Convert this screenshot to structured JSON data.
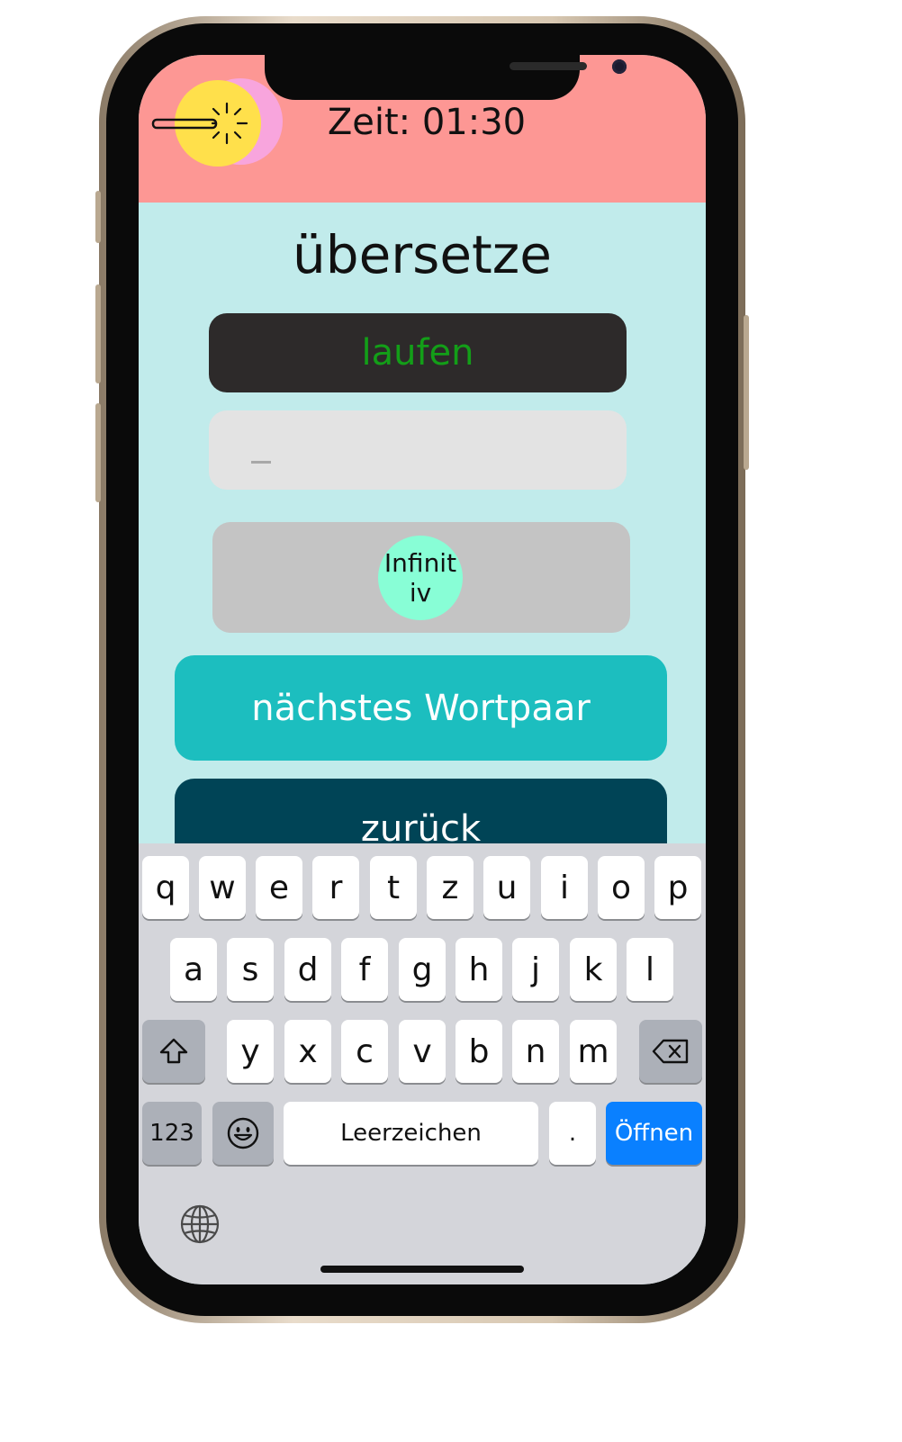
{
  "header": {
    "timer": "Zeit: 01:30",
    "menu_icon": "magic-wand-icon",
    "colors": {
      "header_bg": "#fd9794",
      "menu_yellow": "#ffe04b",
      "menu_pink": "#f8a5dd"
    }
  },
  "main": {
    "title": "übersetze",
    "word": "laufen",
    "answer_value": "",
    "hint_label": "Infinitiv",
    "next_button": "nächstes Wortpaar",
    "back_button": "zurück",
    "colors": {
      "background": "#c1ebeb",
      "word_card_bg": "#2d2a2a",
      "word_text": "#139e18",
      "answer_bg": "#e3e3e3",
      "hint_panel_bg": "#c4c4c4",
      "hint_bubble_bg": "#88fed6",
      "next_button_bg": "#1cbebf",
      "back_button_bg": "#004456"
    }
  },
  "keyboard": {
    "row1": [
      "q",
      "w",
      "e",
      "r",
      "t",
      "z",
      "u",
      "i",
      "o",
      "p"
    ],
    "row2": [
      "a",
      "s",
      "d",
      "f",
      "g",
      "h",
      "j",
      "k",
      "l"
    ],
    "row3": [
      "y",
      "x",
      "c",
      "v",
      "b",
      "n",
      "m"
    ],
    "shift_icon": "shift-icon",
    "backspace_icon": "backspace-icon",
    "numbers_key": "123",
    "emoji_icon": "emoji-icon",
    "space_key": "Leerzeichen",
    "period_key": ".",
    "return_key": "Öffnen",
    "globe_icon": "globe-icon",
    "colors": {
      "return_bg": "#0a80ff",
      "keyboard_bg": "#d4d5da"
    }
  }
}
